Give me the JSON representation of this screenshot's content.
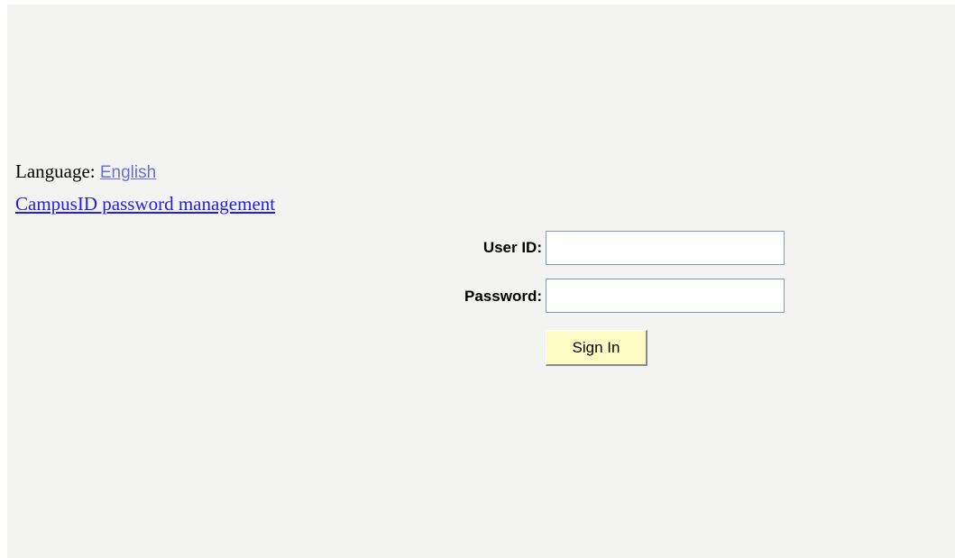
{
  "language": {
    "label": "Language: ",
    "value": "English"
  },
  "links": {
    "password_management": "CampusID password management"
  },
  "login": {
    "user_id_label": "User ID:",
    "user_id_value": "",
    "password_label": "Password:",
    "password_value": "",
    "sign_in_label": "Sign In"
  },
  "colors": {
    "background": "#f3f4f1",
    "link": "#1f1fe6",
    "language_link": "#6b6fd6",
    "button": "#fefcc4",
    "input_border": "#7f9db9"
  }
}
